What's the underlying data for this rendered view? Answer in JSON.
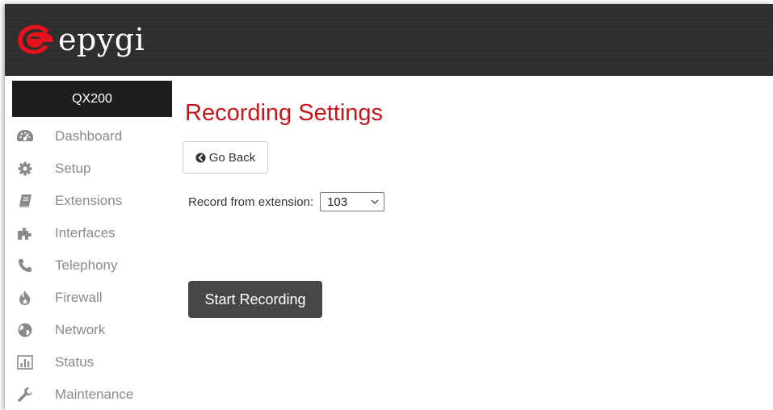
{
  "header": {
    "brand": "epygi"
  },
  "sidebar": {
    "product": "QX200",
    "items": [
      {
        "label": "Dashboard",
        "icon": "dashboard-icon"
      },
      {
        "label": "Setup",
        "icon": "gear-icon"
      },
      {
        "label": "Extensions",
        "icon": "book-icon"
      },
      {
        "label": "Interfaces",
        "icon": "puzzle-icon"
      },
      {
        "label": "Telephony",
        "icon": "phone-icon"
      },
      {
        "label": "Firewall",
        "icon": "fire-icon"
      },
      {
        "label": "Network",
        "icon": "globe-icon"
      },
      {
        "label": "Status",
        "icon": "bar-chart-icon"
      },
      {
        "label": "Maintenance",
        "icon": "wrench-icon"
      }
    ]
  },
  "main": {
    "title": "Recording Settings",
    "back_label": "Go Back",
    "record_from_label": "Record from extension:",
    "extension_value": "103",
    "start_label": "Start Recording"
  },
  "colors": {
    "title": "#c7141a",
    "logo": "#e3121b",
    "header_bg": "#2d2d2d",
    "icon": "#8a8a8a",
    "start_button": "#474747"
  }
}
